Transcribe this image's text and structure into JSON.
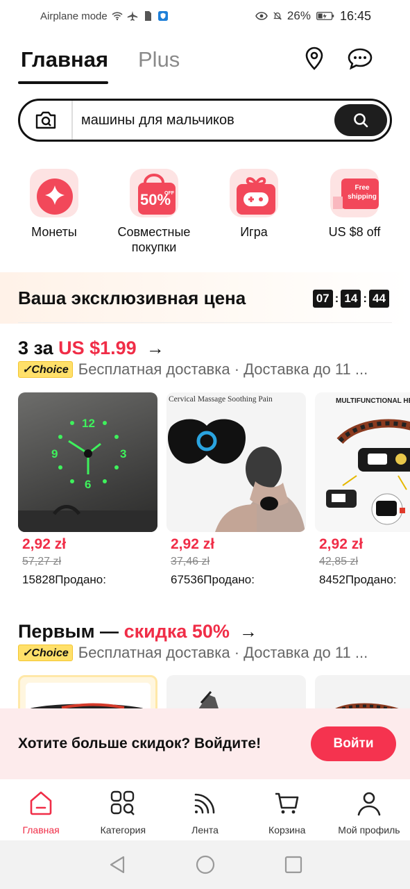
{
  "status_bar": {
    "left_text": "Airplane mode",
    "battery_percent": "26%",
    "time": "16:45"
  },
  "tabs": {
    "main": "Главная",
    "plus": "Plus"
  },
  "search": {
    "query": "машины для мальчиков"
  },
  "quick_actions": [
    {
      "label": "Монеты",
      "icon": "coins-star-icon"
    },
    {
      "label": "Совместные покупки",
      "icon": "fifty-off-bag-icon",
      "badge": "50%",
      "badge_small": "OFF"
    },
    {
      "label": "Игра",
      "icon": "game-gift-icon"
    },
    {
      "label": "US $8 off",
      "icon": "free-shipping-truck-icon",
      "badge": "Free shipping"
    }
  ],
  "exclusive": {
    "title": "Ваша эксклюзивная цена",
    "timer": [
      "07",
      "14",
      "44"
    ]
  },
  "section1": {
    "title_prefix": "3 за ",
    "title_highlight": "US $1.99",
    "arrow": "→",
    "choice_badge": "✓Choice",
    "subtitle": "Бесплатная доставка · Доставка до 11 ...",
    "products": [
      {
        "price": "2,92 zł",
        "old_price": "57,27 zł",
        "sold": "15828Продано:",
        "image": "wall-clock"
      },
      {
        "price": "2,92 zł",
        "old_price": "37,46 zł",
        "sold": "67536Продано:",
        "image": "neck-massager",
        "image_caption": "Cervical Massage Soothing Pain"
      },
      {
        "price": "2,92 zł",
        "old_price": "42,85 zł",
        "sold": "8452Продано:",
        "image": "headlamp",
        "image_caption": "MULTIFUNCTIONAL HEA"
      }
    ]
  },
  "section2": {
    "title_prefix": "Первым — ",
    "title_highlight": "скидка 50%",
    "arrow": "→",
    "choice_badge": "✓Choice",
    "subtitle": "Бесплатная доставка · Доставка до 11 ..."
  },
  "login_banner": {
    "text": "Хотите больше скидок? Войдите!",
    "button": "Войти"
  },
  "bottom_nav": [
    {
      "label": "Главная",
      "icon": "home-icon",
      "active": true
    },
    {
      "label": "Категория",
      "icon": "category-grid-icon",
      "active": false
    },
    {
      "label": "Лента",
      "icon": "feed-rss-icon",
      "active": false
    },
    {
      "label": "Корзина",
      "icon": "cart-icon",
      "active": false
    },
    {
      "label": "Мой профиль",
      "icon": "profile-icon",
      "active": false
    }
  ],
  "colors": {
    "accent": "#f02d47",
    "button": "#f5334f",
    "dark": "#1e1e1e"
  }
}
